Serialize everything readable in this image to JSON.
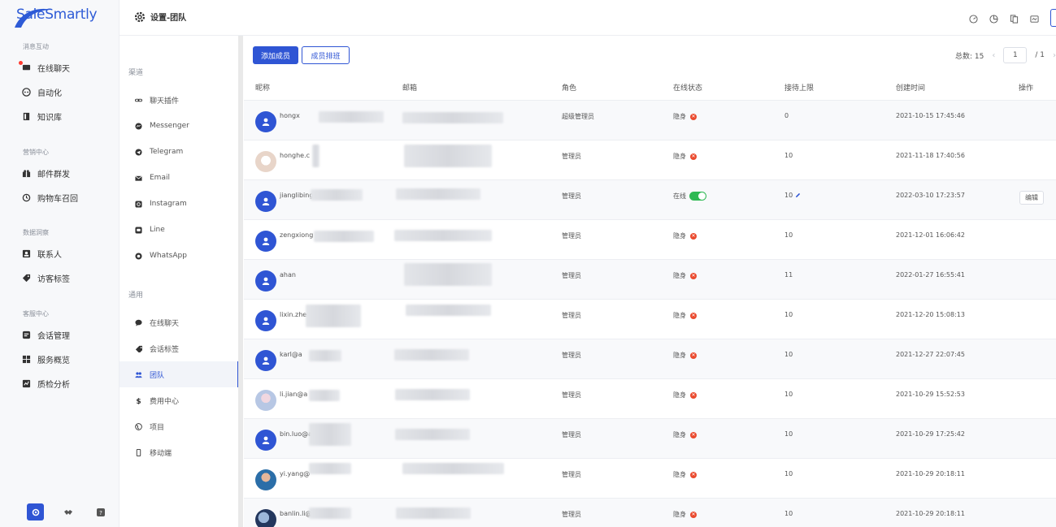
{
  "app": {
    "logo_text": "SaleSmartly",
    "page_title": "设置-团队"
  },
  "colors": {
    "accent": "#2f55d4",
    "online": "#2fb954",
    "offline_badge": "#ea4a2e",
    "sidebar_bg": "#f7f8fa"
  },
  "sidebar": {
    "groups": [
      {
        "title": "消息互动",
        "items": [
          {
            "label": "在线聊天",
            "icon": "chat-icon",
            "dot": true
          },
          {
            "label": "自动化",
            "icon": "robot-icon"
          },
          {
            "label": "知识库",
            "icon": "book-icon"
          }
        ]
      },
      {
        "title": "营销中心",
        "items": [
          {
            "label": "邮件群发",
            "icon": "gift-icon"
          },
          {
            "label": "购物车召回",
            "icon": "recall-icon"
          }
        ]
      },
      {
        "title": "数据洞察",
        "items": [
          {
            "label": "联系人",
            "icon": "contact-icon"
          },
          {
            "label": "访客标签",
            "icon": "tag-icon"
          }
        ]
      },
      {
        "title": "客服中心",
        "items": [
          {
            "label": "会话管理",
            "icon": "session-icon"
          },
          {
            "label": "服务概览",
            "icon": "overview-icon"
          },
          {
            "label": "质检分析",
            "icon": "analysis-icon"
          }
        ]
      }
    ],
    "bottom_icons": [
      "settings-icon",
      "handshake-icon",
      "help-icon"
    ]
  },
  "subnav": {
    "sections": [
      {
        "title": "渠道",
        "items": [
          {
            "label": "聊天插件",
            "icon": "link-icon"
          },
          {
            "label": "Messenger",
            "icon": "messenger-icon"
          },
          {
            "label": "Telegram",
            "icon": "telegram-icon"
          },
          {
            "label": "Email",
            "icon": "email-icon"
          },
          {
            "label": "Instagram",
            "icon": "instagram-icon"
          },
          {
            "label": "Line",
            "icon": "line-icon"
          },
          {
            "label": "WhatsApp",
            "icon": "whatsapp-icon"
          }
        ]
      },
      {
        "title": "通用",
        "items": [
          {
            "label": "在线聊天",
            "icon": "chat-bubble-icon"
          },
          {
            "label": "会话标签",
            "icon": "tag-icon"
          },
          {
            "label": "团队",
            "icon": "team-icon",
            "active": true
          },
          {
            "label": "费用中心",
            "icon": "dollar-icon"
          },
          {
            "label": "项目",
            "icon": "globe-icon"
          },
          {
            "label": "移动端",
            "icon": "mobile-icon"
          }
        ]
      }
    ]
  },
  "toolbar": {
    "add_member": "添加成员",
    "schedule": "成员排班",
    "total_label": "总数: 15",
    "page_current": "1",
    "page_total": "/ 1",
    "prev_arrow": "‹",
    "next_arrow": "›"
  },
  "table": {
    "columns": [
      "昵称",
      "邮箱",
      "角色",
      "在线状态",
      "接待上限",
      "创建时间",
      "操作"
    ],
    "rows": [
      {
        "nick": "hongx",
        "avatar": "default",
        "role": "超级管理员",
        "status": "隐身",
        "limit": "0",
        "created": "2021-10-15 17:45:46"
      },
      {
        "nick": "honghe.c",
        "avatar": "photo1",
        "role": "管理员",
        "status": "隐身",
        "limit": "10",
        "created": "2021-11-18 17:40:56"
      },
      {
        "nick": "jianglibing",
        "avatar": "default",
        "role": "管理员",
        "status": "在线",
        "limit": "10",
        "created": "2022-03-10 17:23:57",
        "action": "编辑"
      },
      {
        "nick": "zengxiong",
        "avatar": "default",
        "role": "管理员",
        "status": "隐身",
        "limit": "10",
        "created": "2021-12-01 16:06:42"
      },
      {
        "nick": "ahan",
        "avatar": "default",
        "role": "管理员",
        "status": "隐身",
        "limit": "11",
        "created": "2022-01-27 16:55:41"
      },
      {
        "nick": "lixin.zhe",
        "avatar": "default",
        "role": "管理员",
        "status": "隐身",
        "limit": "10",
        "created": "2021-12-20 15:08:13"
      },
      {
        "nick": "karl@a",
        "avatar": "default",
        "role": "管理员",
        "status": "隐身",
        "limit": "10",
        "created": "2021-12-27 22:07:45"
      },
      {
        "nick": "li.jian@a",
        "avatar": "photo2",
        "role": "管理员",
        "status": "隐身",
        "limit": "10",
        "created": "2021-10-29 15:52:53"
      },
      {
        "nick": "bin.luo@a",
        "avatar": "default",
        "role": "管理员",
        "status": "隐身",
        "limit": "10",
        "created": "2021-10-29 17:25:42"
      },
      {
        "nick": "yi.yang@",
        "avatar": "photo3",
        "role": "管理员",
        "status": "隐身",
        "limit": "10",
        "created": "2021-10-29 20:18:11"
      },
      {
        "nick": "banlin.li@",
        "avatar": "photo4",
        "role": "管理员",
        "status": "隐身",
        "limit": "10",
        "created": "2021-10-29 20:18:11"
      }
    ]
  }
}
